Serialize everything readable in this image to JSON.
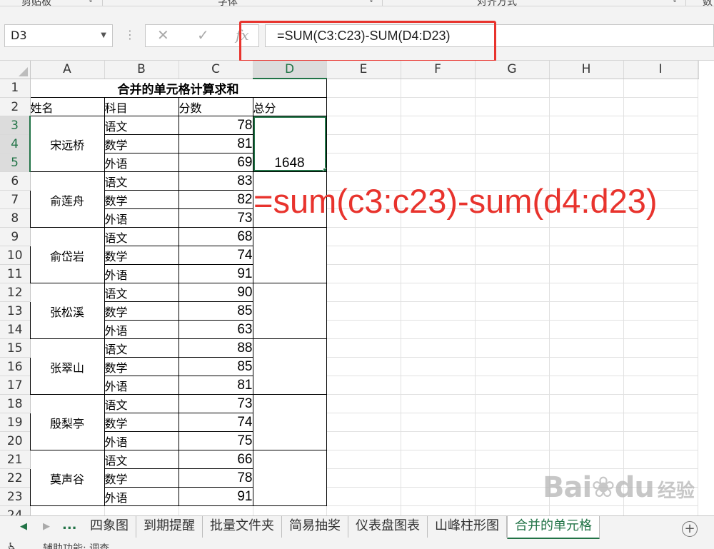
{
  "ribbon": {
    "groups": [
      {
        "label": "剪贴板"
      },
      {
        "label": "字体"
      },
      {
        "label": "对齐方式"
      },
      {
        "label": "数"
      }
    ]
  },
  "formula_bar": {
    "name_box": "D3",
    "cancel_glyph": "✕",
    "enter_glyph": "✓",
    "fx_glyph": "fx",
    "formula": "=SUM(C3:C23)-SUM(D4:D23)"
  },
  "columns": [
    "A",
    "B",
    "C",
    "D",
    "E",
    "F",
    "G",
    "H",
    "I"
  ],
  "active_column": "D",
  "active_rows": [
    3,
    4,
    5
  ],
  "sheet": {
    "title": "合并的单元格计算求和",
    "headers": {
      "name": "姓名",
      "subject": "科目",
      "score": "分数",
      "total": "总分"
    },
    "people": [
      {
        "name": "宋远桥",
        "total": "1648",
        "scores": [
          {
            "subject": "语文",
            "score": "78"
          },
          {
            "subject": "数学",
            "score": "81"
          },
          {
            "subject": "外语",
            "score": "69"
          }
        ]
      },
      {
        "name": "俞莲舟",
        "total": "",
        "scores": [
          {
            "subject": "语文",
            "score": "83"
          },
          {
            "subject": "数学",
            "score": "82"
          },
          {
            "subject": "外语",
            "score": "73"
          }
        ]
      },
      {
        "name": "俞岱岩",
        "total": "",
        "scores": [
          {
            "subject": "语文",
            "score": "68"
          },
          {
            "subject": "数学",
            "score": "74"
          },
          {
            "subject": "外语",
            "score": "91"
          }
        ]
      },
      {
        "name": "张松溪",
        "total": "",
        "scores": [
          {
            "subject": "语文",
            "score": "90"
          },
          {
            "subject": "数学",
            "score": "85"
          },
          {
            "subject": "外语",
            "score": "63"
          }
        ]
      },
      {
        "name": "张翠山",
        "total": "",
        "scores": [
          {
            "subject": "语文",
            "score": "88"
          },
          {
            "subject": "数学",
            "score": "85"
          },
          {
            "subject": "外语",
            "score": "81"
          }
        ]
      },
      {
        "name": "殷梨亭",
        "total": "",
        "scores": [
          {
            "subject": "语文",
            "score": "73"
          },
          {
            "subject": "数学",
            "score": "74"
          },
          {
            "subject": "外语",
            "score": "75"
          }
        ]
      },
      {
        "name": "莫声谷",
        "total": "",
        "scores": [
          {
            "subject": "语文",
            "score": "66"
          },
          {
            "subject": "数学",
            "score": "78"
          },
          {
            "subject": "外语",
            "score": "91"
          }
        ]
      }
    ]
  },
  "annotation": "=sum(c3:c23)-sum(d4:d23)",
  "tabs": {
    "more": "...",
    "items": [
      "四象图",
      "到期提醒",
      "批量文件夹",
      "简易抽奖",
      "仪表盘图表",
      "山峰柱形图",
      "合并的单元格"
    ],
    "active": "合并的单元格",
    "add": "+"
  },
  "status": {
    "text": "辅助功能: 调查"
  },
  "watermark": {
    "main": "Bai",
    "paw": "❀",
    "suffix": "du",
    "sub": "经验"
  },
  "colors": {
    "accent": "#217346",
    "annotation": "#e8332d"
  }
}
